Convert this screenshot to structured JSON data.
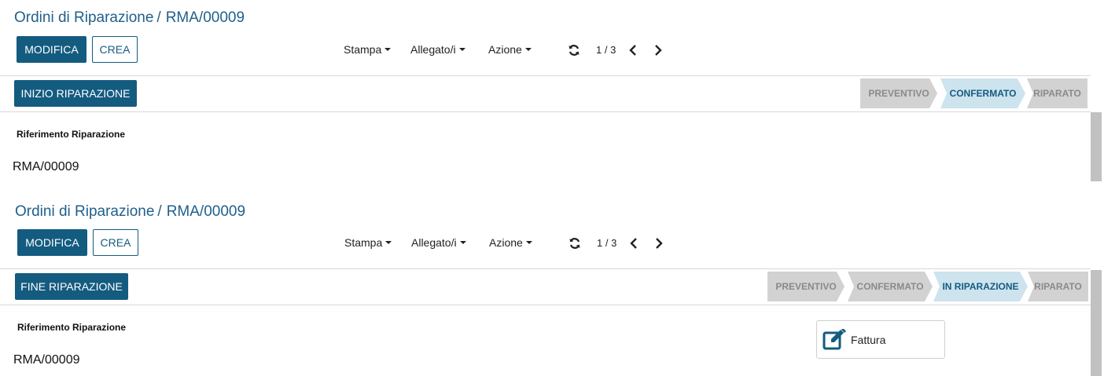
{
  "top": {
    "breadcrumb": {
      "parent": "Ordini di Riparazione",
      "separator": "/",
      "current": "RMA/00009"
    },
    "buttons": {
      "edit": "MODIFICA",
      "create": "CREA"
    },
    "menus": {
      "print": "Stampa",
      "attachments": "Allegato/i",
      "action": "Azione"
    },
    "pager": "1 / 3",
    "status_action": "INIZIO RIPARAZIONE",
    "stages": [
      {
        "label": "PREVENTIVO",
        "active": false
      },
      {
        "label": "CONFERMATO",
        "active": true
      },
      {
        "label": "RIPARATO",
        "active": false
      }
    ],
    "field": {
      "label": "Riferimento Riparazione",
      "value": "RMA/00009"
    }
  },
  "bottom": {
    "breadcrumb": {
      "parent": "Ordini di Riparazione",
      "separator": "/",
      "current": "RMA/00009"
    },
    "buttons": {
      "edit": "MODIFICA",
      "create": "CREA"
    },
    "menus": {
      "print": "Stampa",
      "attachments": "Allegato/i",
      "action": "Azione"
    },
    "pager": "1 / 3",
    "status_action": "FINE RIPARAZIONE",
    "stages": [
      {
        "label": "PREVENTIVO",
        "active": false
      },
      {
        "label": "CONFERMATO",
        "active": false
      },
      {
        "label": "IN RIPARAZIONE",
        "active": true
      },
      {
        "label": "RIPARATO",
        "active": false
      }
    ],
    "field": {
      "label": "Riferimento Riparazione",
      "value": "RMA/00009"
    },
    "smart_button": {
      "label": "Fattura",
      "icon": "edit-square-icon"
    }
  },
  "colors": {
    "primary": "#145b80",
    "breadcrumb": "#1f5f8b",
    "stage_active_bg": "#cde3ee",
    "stage_bg": "#d2d2d2",
    "stage_text": "#8a8a8a"
  },
  "icons": {
    "refresh": "refresh-icon",
    "prev": "chevron-left-icon",
    "next": "chevron-right-icon",
    "caret": "caret-down-icon"
  }
}
